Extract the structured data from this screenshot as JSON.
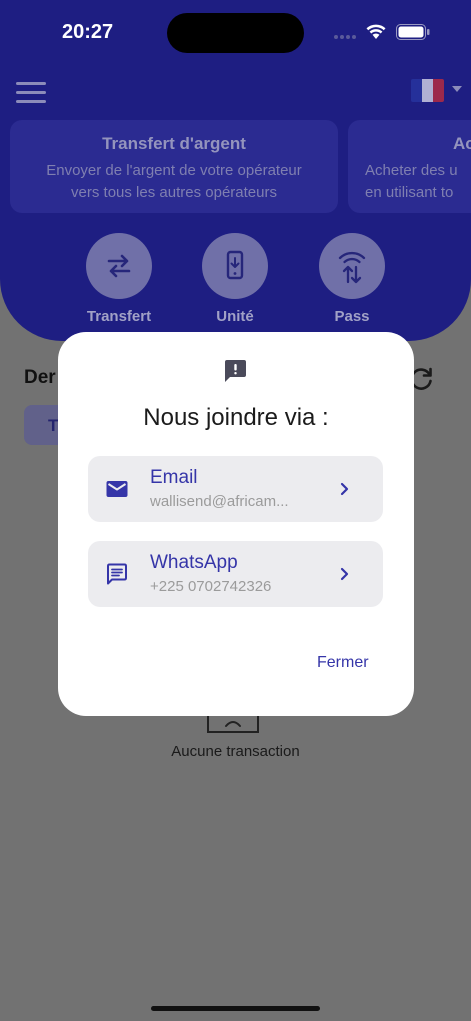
{
  "status_bar": {
    "time": "20:27"
  },
  "header": {
    "menu_icon": "hamburger-menu-icon",
    "language_flag": "france-flag-icon",
    "cards": [
      {
        "title": "Transfert d'argent",
        "description_line1": "Envoyer de l'argent de votre opérateur",
        "description_line2": "vers tous les autres opérateurs"
      },
      {
        "title": "Ac",
        "description_line1": "Acheter des u",
        "description_line2": "en utilisant to"
      }
    ],
    "actions": [
      {
        "label": "Transfert",
        "icon": "transfer-arrows-icon"
      },
      {
        "label": "Unité",
        "icon": "phone-download-icon"
      },
      {
        "label": "Pass",
        "icon": "wifi-data-icon"
      }
    ]
  },
  "main": {
    "section_title": "Der",
    "filter_chip": "T",
    "empty_state": "Aucune transaction"
  },
  "dialog": {
    "icon": "feedback-icon",
    "title": "Nous joindre via :",
    "options": [
      {
        "title": "Email",
        "subtitle": "wallisend@africam...",
        "icon": "email-icon"
      },
      {
        "title": "WhatsApp",
        "subtitle": "+225 0702742326",
        "icon": "chat-icon"
      }
    ],
    "close_label": "Fermer"
  },
  "colors": {
    "brand": "#1e1e82",
    "accent": "#3535a8",
    "overlay": "#727272"
  }
}
